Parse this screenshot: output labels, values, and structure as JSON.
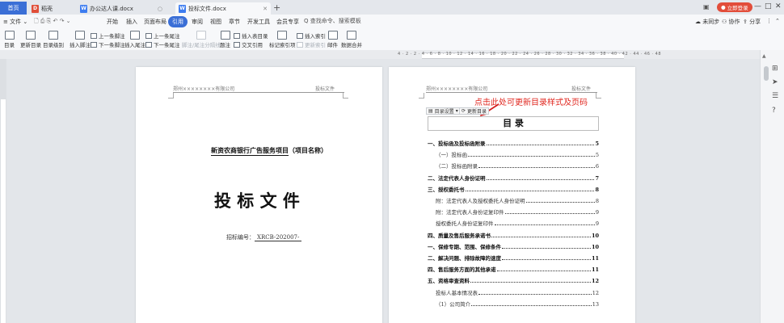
{
  "tabs": [
    {
      "label": "首页",
      "active_home": true
    },
    {
      "label": "稻壳"
    },
    {
      "label": "办公达人课.docx"
    },
    {
      "label": "投标文件.docx",
      "active": true
    }
  ],
  "titlebar": {
    "login_label": "立即登录",
    "window_buttons": [
      "—",
      "□",
      "✕"
    ]
  },
  "menubar": {
    "file_label": "文件",
    "items": [
      "开始",
      "插入",
      "页面布局",
      "引用",
      "审阅",
      "视图",
      "章节",
      "开发工具",
      "会员专享"
    ],
    "active_item": "引用",
    "search_text": "Q 查找命令、搜索模板",
    "right": {
      "sync": "未同步",
      "collab": "协作",
      "share": "分享"
    }
  },
  "ribbon": {
    "big_buttons": [
      "目录",
      "更新目录",
      "目录级别",
      "插入脚注"
    ],
    "notes_group": [
      "上一条脚注",
      "下一条脚注",
      "插入尾注",
      "上一条尾注",
      "下一条尾注",
      "脚注/尾注分隔线"
    ],
    "caption": "题注",
    "caption_group": [
      "插入表目录",
      "交叉引用"
    ],
    "mark_index": "标记索引项",
    "index_group": [
      "插入索引",
      "更新索引"
    ],
    "mail": "邮件",
    "data_merge": "数据合并"
  },
  "page1": {
    "header_left": "郑州××××××××有限公司",
    "header_right": "投标文件",
    "project_name": "新资农商银行广告服务项目",
    "project_label": "（项目名称）",
    "main_title": "投 标 文 件",
    "bid_no_label": "招标编号：",
    "bid_no": "XRCB-202007-"
  },
  "page2": {
    "header_left": "郑州××××××××有限公司",
    "header_right": "投标文件",
    "toc_settings_btn": "目录设置",
    "toc_update_btn": "更新目录",
    "annotation": "点击此处可更新目录样式及页码",
    "annotation_color": "#e0261e",
    "toc_title": "目 录",
    "toc": [
      {
        "text": "一、投标函及投标函附录",
        "page": "5",
        "bold": true
      },
      {
        "text": "（一）投标函",
        "page": "5",
        "indent": true
      },
      {
        "text": "（二）投标函附录",
        "page": "6",
        "indent": true
      },
      {
        "text": "二、法定代表人身份证明",
        "page": "7",
        "bold": true
      },
      {
        "text": "三、授权委托书",
        "page": "8",
        "bold": true
      },
      {
        "text": "附：法定代表人及授权委托人身份证明",
        "page": "8",
        "indent": true
      },
      {
        "text": "附：法定代表人身份证复印件",
        "page": "9",
        "indent": true
      },
      {
        "text": "授权委托人身份证复印件",
        "page": "9",
        "indent": true
      },
      {
        "text": "四、质量及售后服务承诺书",
        "page": "10",
        "bold": true
      },
      {
        "text": "一、保修专期、范围、保修条件",
        "page": "10",
        "bold": true
      },
      {
        "text": "二、解决问题、排除故障的速度",
        "page": "11",
        "bold": true
      },
      {
        "text": "四、售后服务方面的其他承诺",
        "page": "11",
        "bold": true
      },
      {
        "text": "五、资格审查资料",
        "page": "12",
        "bold": true
      },
      {
        "text": "投标人基本情况表",
        "page": "12",
        "indent": true
      },
      {
        "text": "（1）公司简介",
        "page": "13",
        "indent": true
      }
    ]
  },
  "ruler_numbers": "4 · 2 · 2 · 4 · 6 · 8 · 10 · 12 · 14 · 16 · 18 · 20 · 22 · 24 · 26 · 28 · 30 · 32 · 34 · 36 · 38 · 40 · 42 · 44 · 46 · 48",
  "colors": {
    "accent": "#3b6fd6",
    "login": "#e24d3a"
  }
}
